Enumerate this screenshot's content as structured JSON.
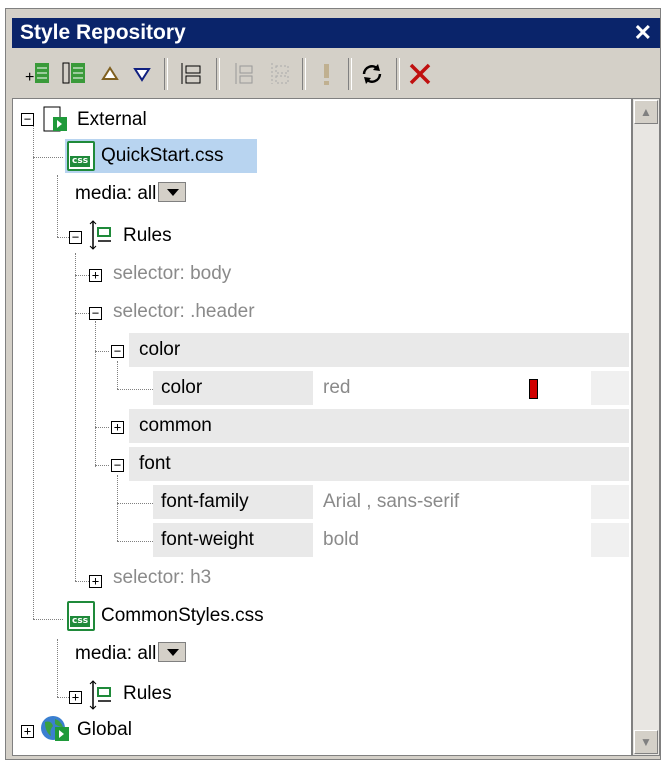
{
  "window": {
    "title": "Style Repository",
    "close_label": "✕"
  },
  "toolbar": {
    "icons": [
      "add-external-icon",
      "add-global-icon",
      "move-up-icon",
      "move-down-icon",
      "expand-all-icon",
      "collapse-icon",
      "reset-icon",
      "important-icon",
      "reload-icon",
      "delete-icon"
    ]
  },
  "tree": {
    "external": "External",
    "quickstart": "QuickStart.css",
    "media_label": "media:",
    "media_value": "all",
    "rules": "Rules",
    "selector_body": "selector: body",
    "selector_header": "selector: .header",
    "group_color": "color",
    "prop_color": "color",
    "prop_color_value": "red",
    "group_common": "common",
    "group_font": "font",
    "prop_font_family": "font-family",
    "prop_font_family_value": "Arial , sans-serif",
    "prop_font_weight": "font-weight",
    "prop_font_weight_value": "bold",
    "selector_h3": "selector: h3",
    "commonstyles": "CommonStyles.css",
    "media2_label": "media:",
    "media2_value": "all",
    "rules2": "Rules",
    "global": "Global",
    "css_badge": "css"
  },
  "colors": {
    "title_bg": "#0a246a",
    "selection": "#b8d4f0",
    "swatch_red": "#d00000"
  }
}
